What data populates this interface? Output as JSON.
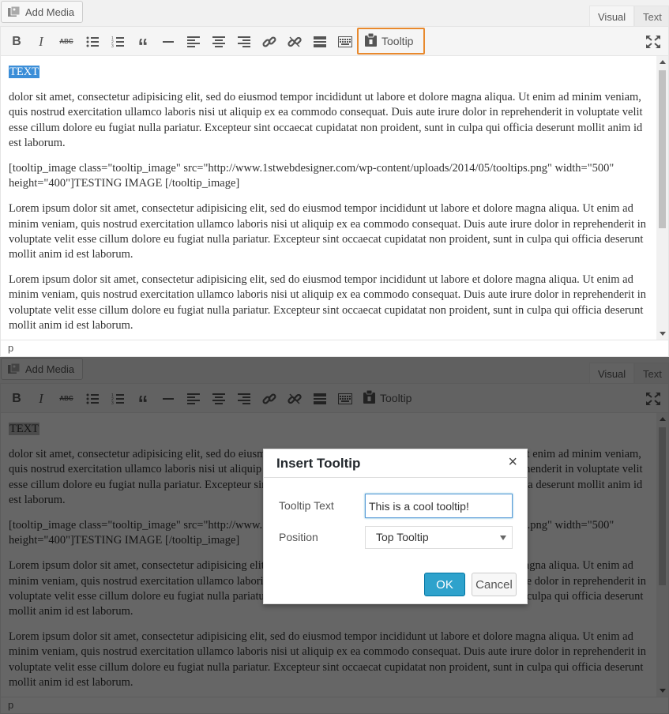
{
  "media": {
    "add_media_label": "Add Media"
  },
  "tabs": {
    "visual": "Visual",
    "text": "Text"
  },
  "toolbar": {
    "tooltip_label": "Tooltip",
    "buttons": [
      "bold",
      "italic",
      "strikethrough",
      "bullet-list",
      "numbered-list",
      "blockquote",
      "horizontal-rule",
      "align-left",
      "align-center",
      "align-right",
      "insert-link",
      "remove-link",
      "read-more",
      "toolbar-toggle"
    ]
  },
  "content": {
    "selected_text": "TEXT",
    "p1": "dolor sit amet, consectetur adipisicing elit, sed do eiusmod tempor incididunt ut labore et dolore magna aliqua. Ut enim ad minim veniam, quis nostrud exercitation ullamco laboris nisi ut aliquip ex ea commodo consequat. Duis aute irure dolor in reprehenderit in voluptate velit esse cillum dolore eu fugiat nulla pariatur. Excepteur sint occaecat cupidatat non proident, sunt in culpa qui officia deserunt mollit anim id est laborum.",
    "shortcode": "[tooltip_image class=\"tooltip_image\" src=\"http://www.1stwebdesigner.com/wp-content/uploads/2014/05/tooltips.png\" width=\"500\" height=\"400\"]TESTING IMAGE [/tooltip_image]",
    "p2": "Lorem ipsum dolor sit amet, consectetur adipisicing elit, sed do eiusmod tempor incididunt ut labore et dolore magna aliqua. Ut enim ad minim veniam, quis nostrud exercitation ullamco laboris nisi ut aliquip ex ea commodo consequat. Duis aute irure dolor in reprehenderit in voluptate velit esse cillum dolore eu fugiat nulla pariatur. Excepteur sint occaecat cupidatat non proident, sunt in culpa qui officia deserunt mollit anim id est laborum.",
    "p3": "Lorem ipsum dolor sit amet, consectetur adipisicing elit, sed do eiusmod tempor incididunt ut labore et dolore magna aliqua. Ut enim ad minim veniam, quis nostrud exercitation ullamco laboris nisi ut aliquip ex ea commodo consequat. Duis aute irure dolor in reprehenderit in voluptate velit esse cillum dolore eu fugiat nulla pariatur. Excepteur sint occaecat cupidatat non proident, sunt in culpa qui officia deserunt mollit anim id est laborum."
  },
  "status": {
    "path": "p"
  },
  "dialog": {
    "title": "Insert Tooltip",
    "close": "×",
    "tooltip_text_label": "Tooltip Text",
    "tooltip_text_value": "This is a cool tooltip!",
    "position_label": "Position",
    "position_value": "Top Tooltip",
    "ok_label": "OK",
    "cancel_label": "Cancel"
  },
  "colors": {
    "highlight_border": "#e8892d",
    "selection": "#3b8ed8",
    "primary_button": "#2ea2cc",
    "overlay": "rgba(0,0,0,0.6)"
  }
}
